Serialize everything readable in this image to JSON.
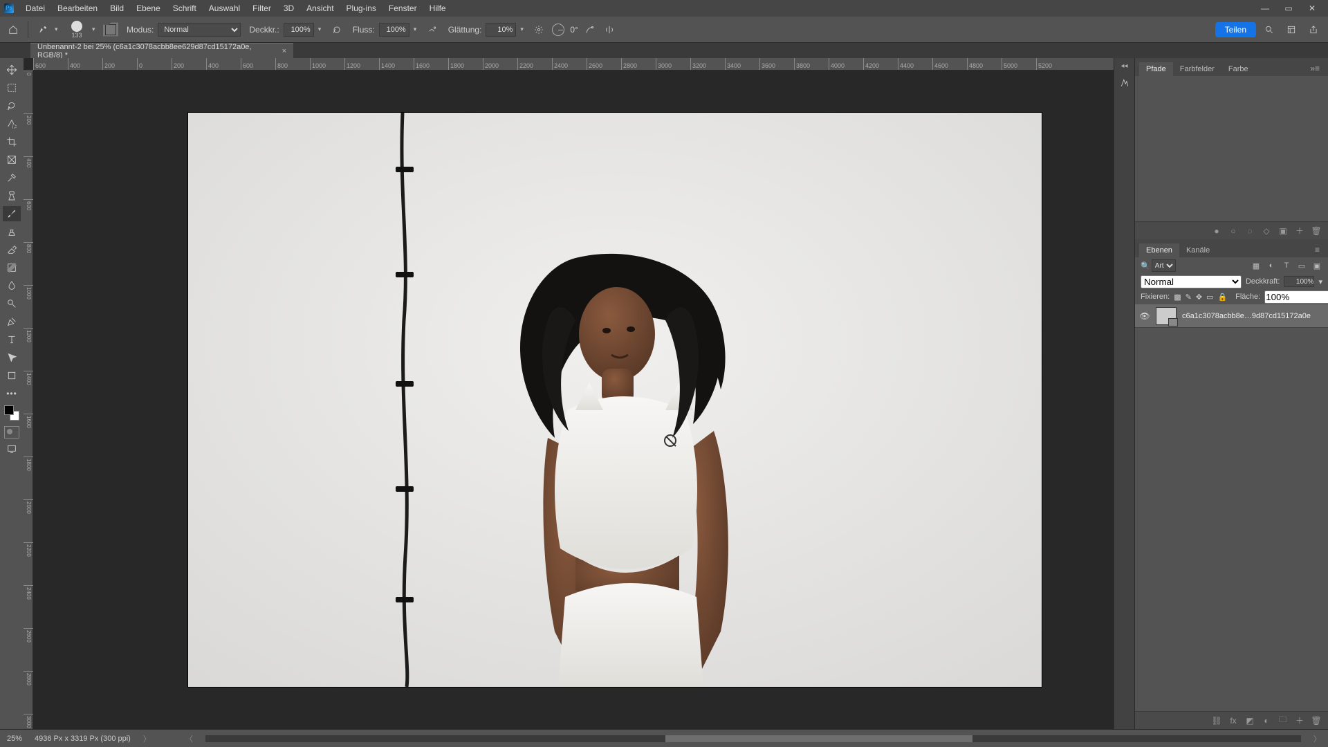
{
  "menu": {
    "items": [
      "Datei",
      "Bearbeiten",
      "Bild",
      "Ebene",
      "Schrift",
      "Auswahl",
      "Filter",
      "3D",
      "Ansicht",
      "Plug-ins",
      "Fenster",
      "Hilfe"
    ]
  },
  "optbar": {
    "brush_size": "133",
    "mode_label": "Modus:",
    "mode_value": "Normal",
    "opacity_label": "Deckkr.:",
    "opacity_value": "100%",
    "flow_label": "Fluss:",
    "flow_value": "100%",
    "smoothing_label": "Glättung:",
    "smoothing_value": "10%",
    "angle_value": "0°",
    "share_label": "Teilen"
  },
  "tab": {
    "title": "Unbenannt-2 bei 25% (c6a1c3078acbb8ee629d87cd15172a0e, RGB/8) *"
  },
  "hruler_ticks": [
    "600",
    "400",
    "200",
    "0",
    "200",
    "400",
    "600",
    "800",
    "1000",
    "1200",
    "1400",
    "1600",
    "1800",
    "2000",
    "2200",
    "2400",
    "2600",
    "2800",
    "3000",
    "3200",
    "3400",
    "3600",
    "3800",
    "4000",
    "4200",
    "4400",
    "4600",
    "4800",
    "5000",
    "5200"
  ],
  "vruler_ticks": [
    "0",
    "200",
    "400",
    "600",
    "800",
    "1000",
    "1200",
    "1400",
    "1600",
    "1800",
    "2000",
    "2200",
    "2400",
    "2600",
    "2800",
    "3000"
  ],
  "panels": {
    "paths_tabs": [
      "Pfade",
      "Farbfelder",
      "Farbe"
    ],
    "layers_tabs": [
      "Ebenen",
      "Kanäle"
    ],
    "search_kind": "Art",
    "blend_mode": "Normal",
    "opacity_label": "Deckkraft:",
    "opacity_value": "100%",
    "lock_label": "Fixieren:",
    "fill_label": "Fläche:",
    "fill_value": "100%",
    "layer_name": "c6a1c3078acbb8e…9d87cd15172a0e"
  },
  "status": {
    "zoom": "25%",
    "docinfo": "4936 Px x 3319 Px (300 ppi)"
  },
  "colors": {
    "accent": "#1473e6"
  }
}
